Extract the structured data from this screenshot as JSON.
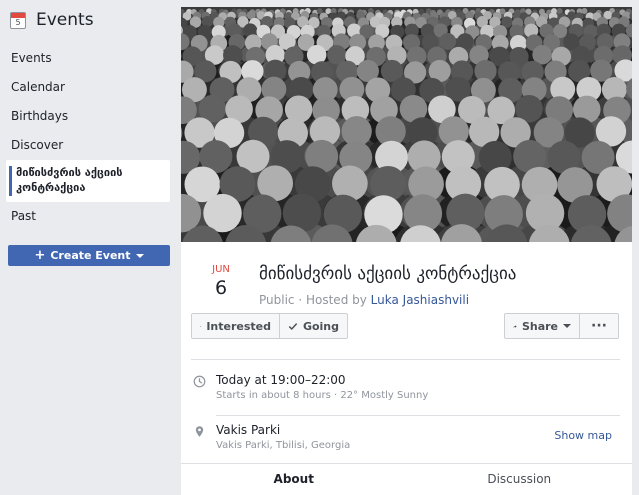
{
  "sidebar": {
    "title": "Events",
    "calendar_day": "5",
    "items": [
      {
        "label": "Events"
      },
      {
        "label": "Calendar"
      },
      {
        "label": "Birthdays"
      },
      {
        "label": "Discover"
      },
      {
        "label": "მიწისძვრის აქციის კონტრაქცია"
      },
      {
        "label": "Past"
      }
    ],
    "create_label": "Create Event"
  },
  "event": {
    "month": "JUN",
    "day": "6",
    "title": "მიწისძვრის აქციის კონტრაქცია",
    "privacy": "Public",
    "hosted_prefix": "Hosted by",
    "host": "Luka Jashiashvili",
    "time": "Today at 19:00–22:00",
    "time_sub": "Starts in about 8 hours · 22° Mostly Sunny",
    "place": "Vakis Parki",
    "place_sub": "Vakis Parki, Tbilisi, Georgia",
    "show_map": "Show map"
  },
  "actions": {
    "interested": "Interested",
    "going": "Going",
    "share": "Share",
    "more": "···"
  },
  "tabs": [
    {
      "label": "About"
    },
    {
      "label": "Discussion"
    }
  ],
  "colors": {
    "accent": "#4267b2",
    "link": "#365899",
    "date_red": "#e04a3f"
  }
}
